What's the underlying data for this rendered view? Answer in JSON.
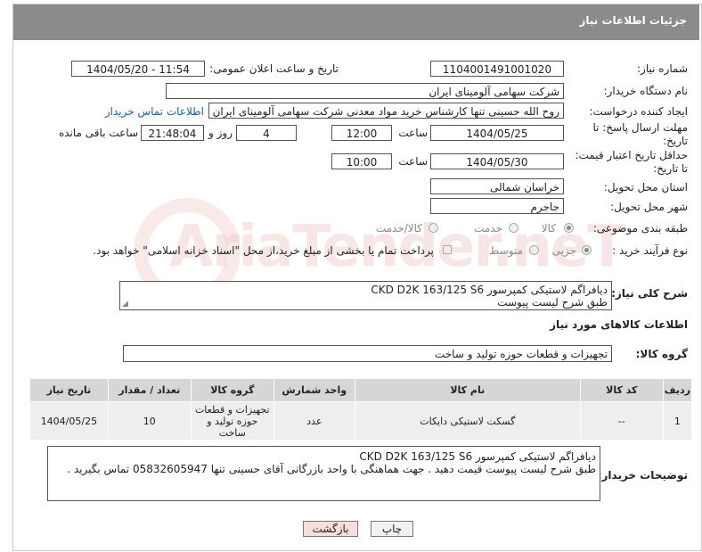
{
  "header": {
    "title": "جزئیات اطلاعات نیاز"
  },
  "fields": {
    "need_number_label": "شماره نیاز:",
    "need_number": "1104001491001020",
    "announce_label": "تاریخ و ساعت اعلان عمومی:",
    "announce_value": "1404/05/20 - 11:54",
    "buyer_org_label": "نام دستگاه خریدار:",
    "buyer_org": "شرکت سهامی آلومینای ایران",
    "creator_label": "ایجاد کننده درخواست:",
    "creator": "روح الله حسینی تنها کارشناس خرید مواد معدنی شرکت سهامی آلومینای ایران",
    "contact_link": "اطلاعات تماس خریدار",
    "deadline_label_1": "مهلت ارسال پاسخ: تا",
    "deadline_label_2": "تاریخ:",
    "deadline_date": "1404/05/25",
    "time_label": "ساعت",
    "deadline_time": "12:00",
    "days_value": "4",
    "days_label": "روز و",
    "remaining_time": "21:48:04",
    "remaining_label": "ساعت باقی مانده",
    "validity_label_1": "حداقل تاریخ اعتبار قیمت:",
    "validity_label_2": "تا تاریخ:",
    "validity_date": "1404/05/30",
    "validity_time": "10:00",
    "province_label": "استان محل تحویل:",
    "province": "خراسان شمالی",
    "city_label": "شهر محل تحویل:",
    "city": "جاجرم",
    "category_label": "طبقه بندی موضوعی:",
    "cat_goods": "کالا",
    "cat_service": "خدمت",
    "cat_both": "کالا/خدمت",
    "process_label": "نوع فرآیند خرید :",
    "proc_partial": "جزیی",
    "proc_medium": "متوسط",
    "payment_note": "پرداخت تمام یا بخشی از مبلغ خرید،از محل \"اسناد خزانه اسلامی\" خواهد بود."
  },
  "description": {
    "label": "شرح کلی نیاز:",
    "line1": "دیافراگم لاستیکی  کمپرسور CKD D2K 163/125 S6",
    "line2": "طبق شرح لیست پیوست"
  },
  "goods_info": {
    "section_title": "اطلاعات کالاهای مورد نیاز",
    "group_label": "گروه کالا:",
    "group_value": "تجهیزات و قطعات حوزه تولید و ساخت"
  },
  "table": {
    "headers": [
      "ردیف",
      "کد کالا",
      "نام کالا",
      "واحد شمارش",
      "گروه کالا",
      "تعداد / مقدار",
      "تاریخ نیاز"
    ],
    "rows": [
      {
        "row": "1",
        "code": "--",
        "name": "گسکت لاستیکی دایکات",
        "unit": "عدد",
        "group": "تجهیزات و قطعات حوزه تولید و ساخت",
        "qty": "10",
        "date": "1404/05/25"
      }
    ]
  },
  "buyer_notes": {
    "label": "توضیحات خریدار:",
    "line1": "دیافراگم لاستیکی  کمپرسور CKD D2K 163/125 S6",
    "line2": "طبق شرح لیست پیوست قیمت دهید . جهت هماهنگی با واحد بازرگانی آقای حسینی تنها 05832605947 تماس بگیرید ."
  },
  "buttons": {
    "print": "چاپ",
    "back": "بازگشت"
  },
  "watermark": {
    "text": "AriaTender.neT"
  },
  "colors": {
    "header_bg": "#8b8b8b",
    "link": "#1a5fa8",
    "back_btn_bg": "#f6dede",
    "table_head": "#d6d6d6"
  }
}
